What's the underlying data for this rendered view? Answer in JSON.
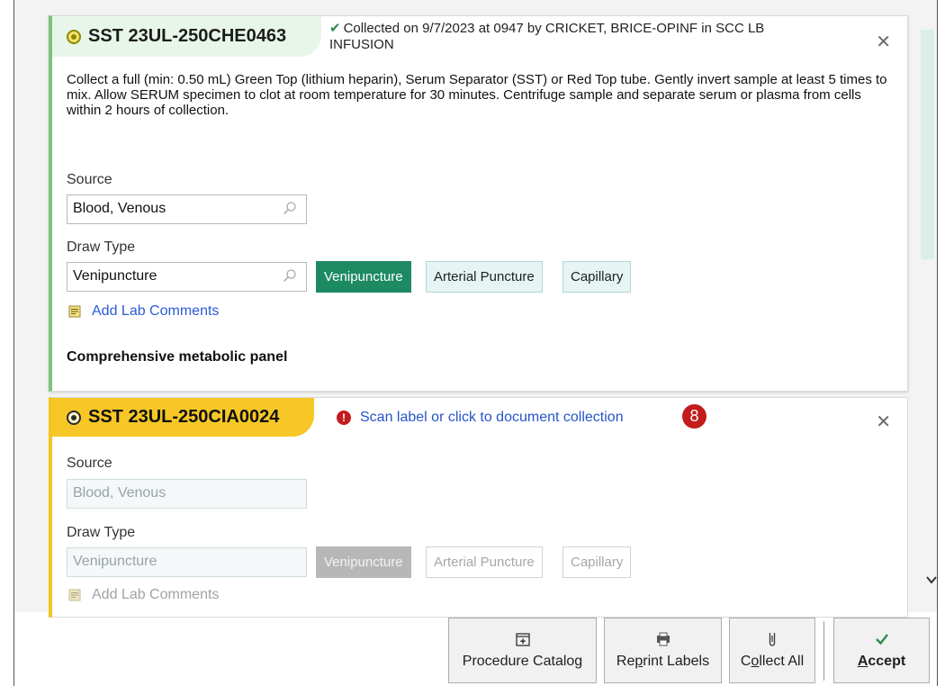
{
  "specimens": [
    {
      "id": "SST 23UL-250CHE0463",
      "status": "Collected on 9/7/2023 at 0947 by CRICKET, BRICE-OPINF in SCC LB INFUSION",
      "instructions": "Collect a full (min: 0.50 mL) Green Top (lithium heparin), Serum Separator (SST) or Red Top tube.  Gently invert sample at least 5 times to mix. Allow SERUM specimen to clot at room temperature for 30 minutes. Centrifuge sample and separate serum or plasma from cells within 2 hours of collection.",
      "source_label": "Source",
      "source_value": "Blood, Venous",
      "draw_type_label": "Draw Type",
      "draw_type_value": "Venipuncture",
      "draw_options": [
        "Venipuncture",
        "Arterial Puncture",
        "Capillary"
      ],
      "selected_draw_option": "Venipuncture",
      "add_comments": "Add Lab Comments",
      "panel": "Comprehensive metabolic panel",
      "accent_color": "#7ec27e"
    },
    {
      "id": "SST 23UL-250CIA0024",
      "scan_prompt": "Scan label or click to document collection",
      "pending_count": "8",
      "source_label": "Source",
      "source_value": "Blood, Venous",
      "draw_type_label": "Draw Type",
      "draw_type_value": "Venipuncture",
      "draw_options": [
        "Venipuncture",
        "Arterial Puncture",
        "Capillary"
      ],
      "selected_draw_option": "Venipuncture",
      "add_comments": "Add Lab Comments",
      "accent_color": "#f3c51e"
    }
  ],
  "toolbar": {
    "procedure_catalog": "Procedure Catalog",
    "reprint_labels_pre": "Re",
    "reprint_labels_key": "p",
    "reprint_labels_post": "rint Labels",
    "collect_all_pre": "C",
    "collect_all_key": "o",
    "collect_all_post": "llect All",
    "accept_key": "A",
    "accept_post": "ccept"
  },
  "icons": {
    "close": "close-icon",
    "search": "search-icon",
    "check": "check-icon",
    "alert": "alert-icon",
    "note": "note-icon"
  },
  "colors": {
    "selected_green": "#1e8a63",
    "link_blue": "#2754c9",
    "alert_red": "#c41b1b",
    "collected_pill": "#e8f6e9",
    "pending_pill": "#f6c726"
  }
}
